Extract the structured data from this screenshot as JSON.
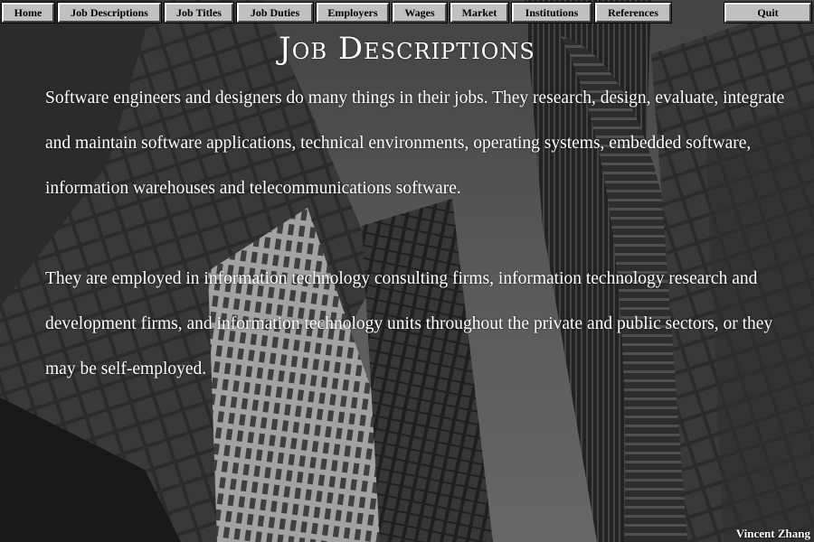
{
  "nav": {
    "home": "Home",
    "job_descriptions": "Job Descriptions",
    "job_titles": "Job Titles",
    "job_duties": "Job Duties",
    "employers": "Employers",
    "wages": "Wages",
    "market": "Market",
    "institutions": "Institutions",
    "references": "References",
    "quit": "Quit"
  },
  "page": {
    "title": "Job Descriptions",
    "paragraphs": [
      "Software engineers and designers do many things in their jobs. They research, design, evaluate, integrate and maintain software applications, technical environments, operating systems, embedded software, information warehouses and telecommunications software.",
      "They are employed in information technology consulting firms, information technology research and development firms, and information technology units throughout the private and public sectors, or they may be self-employed."
    ],
    "author": "Vincent Zhang"
  },
  "colors": {
    "button_face": "#c0c0c0",
    "text": "#ffffff",
    "background": "#2a2a2a"
  }
}
